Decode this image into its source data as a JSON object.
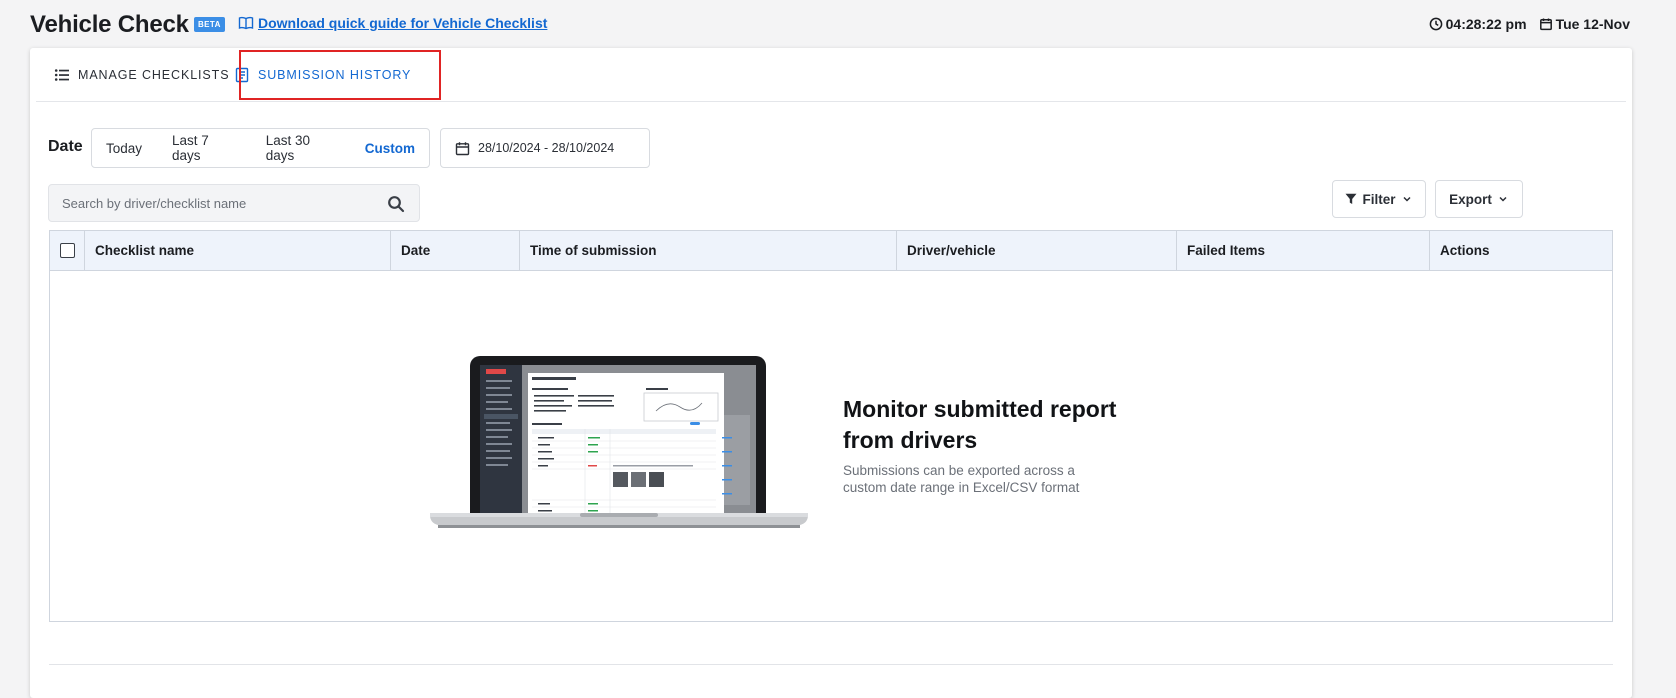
{
  "header": {
    "title": "Vehicle Check",
    "badge": "BETA",
    "guide_link": "Download quick guide for Vehicle Checklist",
    "time": "04:28:22 pm",
    "date": "Tue 12-Nov"
  },
  "tabs": [
    {
      "label": "MANAGE CHECKLISTS",
      "icon": "list-icon",
      "active": false
    },
    {
      "label": "SUBMISSION HISTORY",
      "icon": "document-icon",
      "active": true
    }
  ],
  "date_filter": {
    "label": "Date",
    "options": [
      "Today",
      "Last 7 days",
      "Last 30 days",
      "Custom"
    ],
    "selected": "Custom",
    "range": "28/10/2024 - 28/10/2024"
  },
  "search": {
    "placeholder": "Search by driver/checklist name",
    "value": ""
  },
  "toolbar": {
    "filter_label": "Filter",
    "export_label": "Export"
  },
  "table": {
    "columns": [
      "Checklist name",
      "Date",
      "Time of submission",
      "Driver/vehicle",
      "Failed Items",
      "Actions"
    ],
    "rows": []
  },
  "empty_state": {
    "title": "Monitor submitted report from drivers",
    "description": "Submissions can be exported across a custom date range in Excel/CSV format"
  },
  "colors": {
    "accent": "#1368d1",
    "badge": "#3b8ee6",
    "highlight_outline": "#e02424",
    "table_header_bg": "#eef3fb"
  }
}
